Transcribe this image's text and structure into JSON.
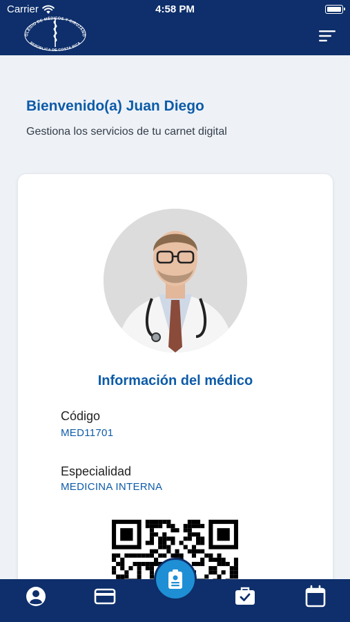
{
  "status_bar": {
    "carrier": "Carrier",
    "time": "4:58 PM",
    "wifi_icon": "wifi-icon",
    "battery_icon": "battery-icon"
  },
  "header": {
    "logo_icon": "colegio-medicos-logo",
    "logo_text_top": "COLEGIO DE MÉDICOS Y CIRUJANOS",
    "logo_text_bottom": "REPÚBLICA DE COSTA RICA",
    "menu_icon": "sort-menu-icon",
    "background_color": "#0e2f6b"
  },
  "welcome": {
    "title": "Bienvenido(a) Juan Diego",
    "subtitle": "Gestiona los servicios de tu carnet digital"
  },
  "card": {
    "photo_icon": "doctor-photo",
    "info_title": "Información del médico",
    "fields": [
      {
        "label": "Código",
        "value": "MED11701"
      },
      {
        "label": "Especialidad",
        "value": "MEDICINA INTERNA"
      }
    ],
    "qr_icon": "qr-code"
  },
  "bottom_nav": {
    "items": [
      "profile-icon",
      "credit-card-icon",
      "badge-icon",
      "briefcase-check-icon",
      "calendar-icon"
    ],
    "fab_color": "#1e8fd4"
  },
  "colors": {
    "primary": "#0e2f6b",
    "accent_text": "#0d5ba8",
    "background": "#eef2f7"
  }
}
